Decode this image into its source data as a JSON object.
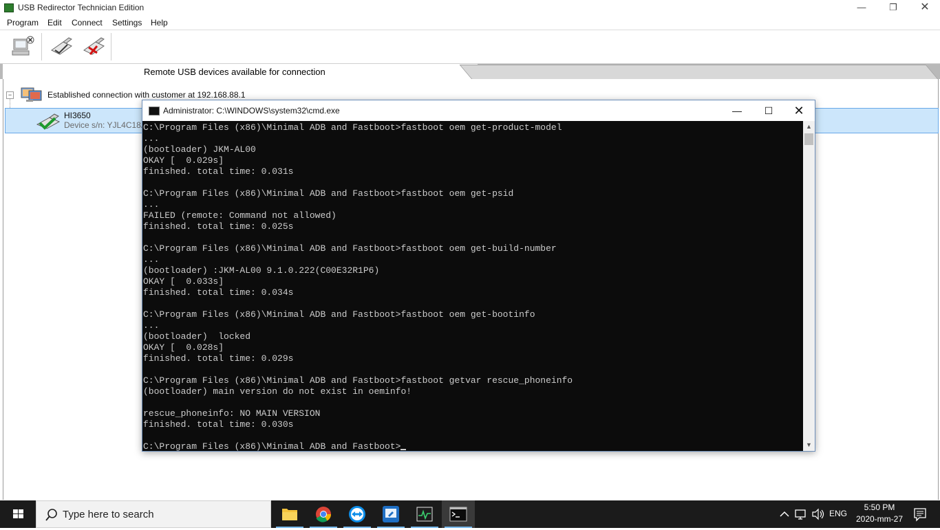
{
  "app": {
    "title": "USB Redirector Technician Edition",
    "window_controls": {
      "minimize": "—",
      "maximize": "❐",
      "close": "✕"
    }
  },
  "menu": [
    "Program",
    "Edit",
    "Connect",
    "Settings",
    "Help"
  ],
  "tabs": {
    "active_label": "Remote USB devices available for connection"
  },
  "tree": {
    "toggle": "−",
    "connection_label": "Established connection with customer at 192.168.88.1",
    "device": {
      "name": "HI3650",
      "serial": "Device s/n: YJL4C18A"
    }
  },
  "cmd": {
    "title": "Administrator: C:\\WINDOWS\\system32\\cmd.exe",
    "controls": {
      "minimize": "—",
      "maximize": "☐",
      "close": "✕"
    },
    "output": "C:\\Program Files (x86)\\Minimal ADB and Fastboot>fastboot oem get-product-model\n...\n(bootloader) JKM-AL00\nOKAY [  0.029s]\nfinished. total time: 0.031s\n\nC:\\Program Files (x86)\\Minimal ADB and Fastboot>fastboot oem get-psid\n...\nFAILED (remote: Command not allowed)\nfinished. total time: 0.025s\n\nC:\\Program Files (x86)\\Minimal ADB and Fastboot>fastboot oem get-build-number\n...\n(bootloader) :JKM-AL00 9.1.0.222(C00E32R1P6)\nOKAY [  0.033s]\nfinished. total time: 0.034s\n\nC:\\Program Files (x86)\\Minimal ADB and Fastboot>fastboot oem get-bootinfo\n...\n(bootloader)  locked\nOKAY [  0.028s]\nfinished. total time: 0.029s\n\nC:\\Program Files (x86)\\Minimal ADB and Fastboot>fastboot getvar rescue_phoneinfo\n(bootloader) main version do not exist in oeminfo!\n\nrescue_phoneinfo: NO MAIN VERSION\nfinished. total time: 0.030s\n\nC:\\Program Files (x86)\\Minimal ADB and Fastboot>",
    "scroll_arrows": {
      "up": "▲",
      "down": "▼"
    }
  },
  "taskbar": {
    "search_placeholder": "Type here to search",
    "apps": [
      "file-explorer",
      "chrome",
      "teamviewer",
      "remote-desktop",
      "activity-monitor",
      "command-prompt"
    ],
    "language": "ENG",
    "time": "5:50 PM",
    "date": "2020-mm-27"
  }
}
